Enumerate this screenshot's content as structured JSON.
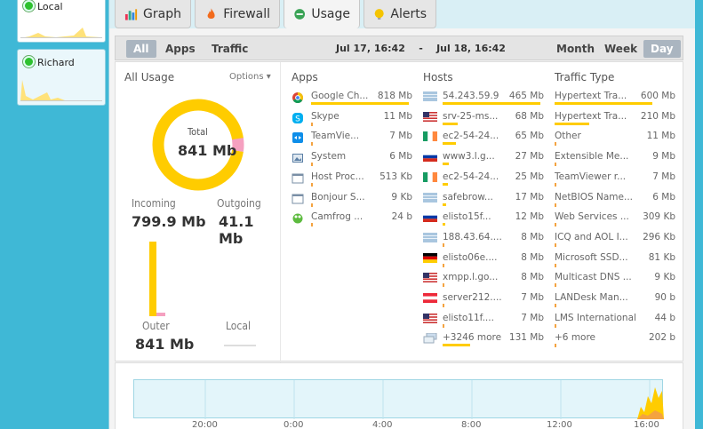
{
  "sidebar": {
    "devices": [
      {
        "name": "Local"
      },
      {
        "name": "Richard"
      }
    ]
  },
  "tabs": [
    {
      "label": "Graph",
      "icon": "graph-icon"
    },
    {
      "label": "Firewall",
      "icon": "flame-icon"
    },
    {
      "label": "Usage",
      "icon": "usage-icon"
    },
    {
      "label": "Alerts",
      "icon": "alert-icon"
    }
  ],
  "toolbar": {
    "all_label": "All",
    "apps_label": "Apps",
    "traffic_label": "Traffic",
    "date_start": "Jul 17, 16:42",
    "date_sep": "-",
    "date_end": "Jul 18, 16:42",
    "month_label": "Month",
    "week_label": "Week",
    "day_label": "Day"
  },
  "all_usage": {
    "title": "All Usage",
    "options_label": "Options ▾",
    "total_label": "Total",
    "total_value": "841 Mb",
    "incoming_label": "Incoming",
    "incoming_value": "799.9 Mb",
    "outgoing_label": "Outgoing",
    "outgoing_value": "41.1 Mb",
    "outer_label": "Outer",
    "outer_value": "841 Mb",
    "local_label": "Local",
    "incoming_fraction": 0.951,
    "outgoing_fraction": 0.049
  },
  "apps": {
    "title": "Apps",
    "rows": [
      {
        "name": "Google Ch...",
        "value": "818 Mb",
        "icon": "chrome-icon",
        "fraction": 1.0
      },
      {
        "name": "Skype",
        "value": "11 Mb",
        "icon": "skype-icon",
        "fraction": 0.0
      },
      {
        "name": "TeamVie...",
        "value": "7 Mb",
        "icon": "teamviewer-icon",
        "fraction": 0.0
      },
      {
        "name": "System",
        "value": "6 Mb",
        "icon": "system-icon",
        "fraction": 0.0
      },
      {
        "name": "Host Proc...",
        "value": "513 Kb",
        "icon": "window-icon",
        "fraction": 0.0
      },
      {
        "name": "Bonjour S...",
        "value": "9 Kb",
        "icon": "window-icon",
        "fraction": 0.0
      },
      {
        "name": "Camfrog ...",
        "value": "24 b",
        "icon": "camfrog-icon",
        "fraction": 0.0
      }
    ]
  },
  "hosts": {
    "title": "Hosts",
    "rows": [
      {
        "name": "54.243.59.9",
        "value": "465 Mb",
        "icon": "flag-generic-icon",
        "fraction": 1.0
      },
      {
        "name": "srv-25-ms...",
        "value": "68 Mb",
        "icon": "flag-us-icon",
        "fraction": 0.15
      },
      {
        "name": "ec2-54-24...",
        "value": "65 Mb",
        "icon": "flag-ie-icon",
        "fraction": 0.14
      },
      {
        "name": "www3.l.g...",
        "value": "27 Mb",
        "icon": "flag-ru-icon",
        "fraction": 0.06
      },
      {
        "name": "ec2-54-24...",
        "value": "25 Mb",
        "icon": "flag-ie-icon",
        "fraction": 0.05
      },
      {
        "name": "safebrow...",
        "value": "17 Mb",
        "icon": "flag-generic-icon",
        "fraction": 0.04
      },
      {
        "name": "elisto15f...",
        "value": "12 Mb",
        "icon": "flag-ru-icon",
        "fraction": 0.03
      },
      {
        "name": "188.43.64....",
        "value": "8 Mb",
        "icon": "flag-generic-icon",
        "fraction": 0.02
      },
      {
        "name": "elisto06e....",
        "value": "8 Mb",
        "icon": "flag-de-icon",
        "fraction": 0.02
      },
      {
        "name": "xmpp.l.go...",
        "value": "8 Mb",
        "icon": "flag-us-icon",
        "fraction": 0.02
      },
      {
        "name": "server212....",
        "value": "7 Mb",
        "icon": "flag-at-icon",
        "fraction": 0.01
      },
      {
        "name": "elisto11f....",
        "value": "7 Mb",
        "icon": "flag-us-icon",
        "fraction": 0.01
      },
      {
        "name": "+3246 more",
        "value": "131 Mb",
        "icon": "stack-icon",
        "fraction": 0.28
      }
    ]
  },
  "traffic": {
    "title": "Traffic Type",
    "rows": [
      {
        "name": "Hypertext Tra...",
        "value": "600 Mb",
        "fraction": 1.0
      },
      {
        "name": "Hypertext Tra...",
        "value": "210 Mb",
        "fraction": 0.35
      },
      {
        "name": "Other",
        "value": "11 Mb",
        "fraction": 0.0
      },
      {
        "name": "Extensible Me...",
        "value": "9 Mb",
        "fraction": 0.0
      },
      {
        "name": "TeamViewer r...",
        "value": "7 Mb",
        "fraction": 0.0
      },
      {
        "name": "NetBIOS Name...",
        "value": "6 Mb",
        "fraction": 0.0
      },
      {
        "name": "Web Services ...",
        "value": "309 Kb",
        "fraction": 0.0
      },
      {
        "name": "ICQ and AOL I...",
        "value": "296 Kb",
        "fraction": 0.0
      },
      {
        "name": "Microsoft SSD...",
        "value": "81 Kb",
        "fraction": 0.0
      },
      {
        "name": "Multicast DNS ...",
        "value": "9 Kb",
        "fraction": 0.0
      },
      {
        "name": "LANDesk Man...",
        "value": "90 b",
        "fraction": 0.0
      },
      {
        "name": "LMS International",
        "value": "44 b",
        "fraction": 0.0
      },
      {
        "name": "+6 more",
        "value": "202 b",
        "fraction": 0.0
      }
    ]
  },
  "timeline": {
    "labels": [
      "20:00",
      "0:00",
      "4:00",
      "8:00",
      "12:00",
      "16:00"
    ]
  },
  "colors": {
    "accent": "#ffcc00",
    "outgoing": "#f5a0c0",
    "frame": "#3fb8d6"
  }
}
